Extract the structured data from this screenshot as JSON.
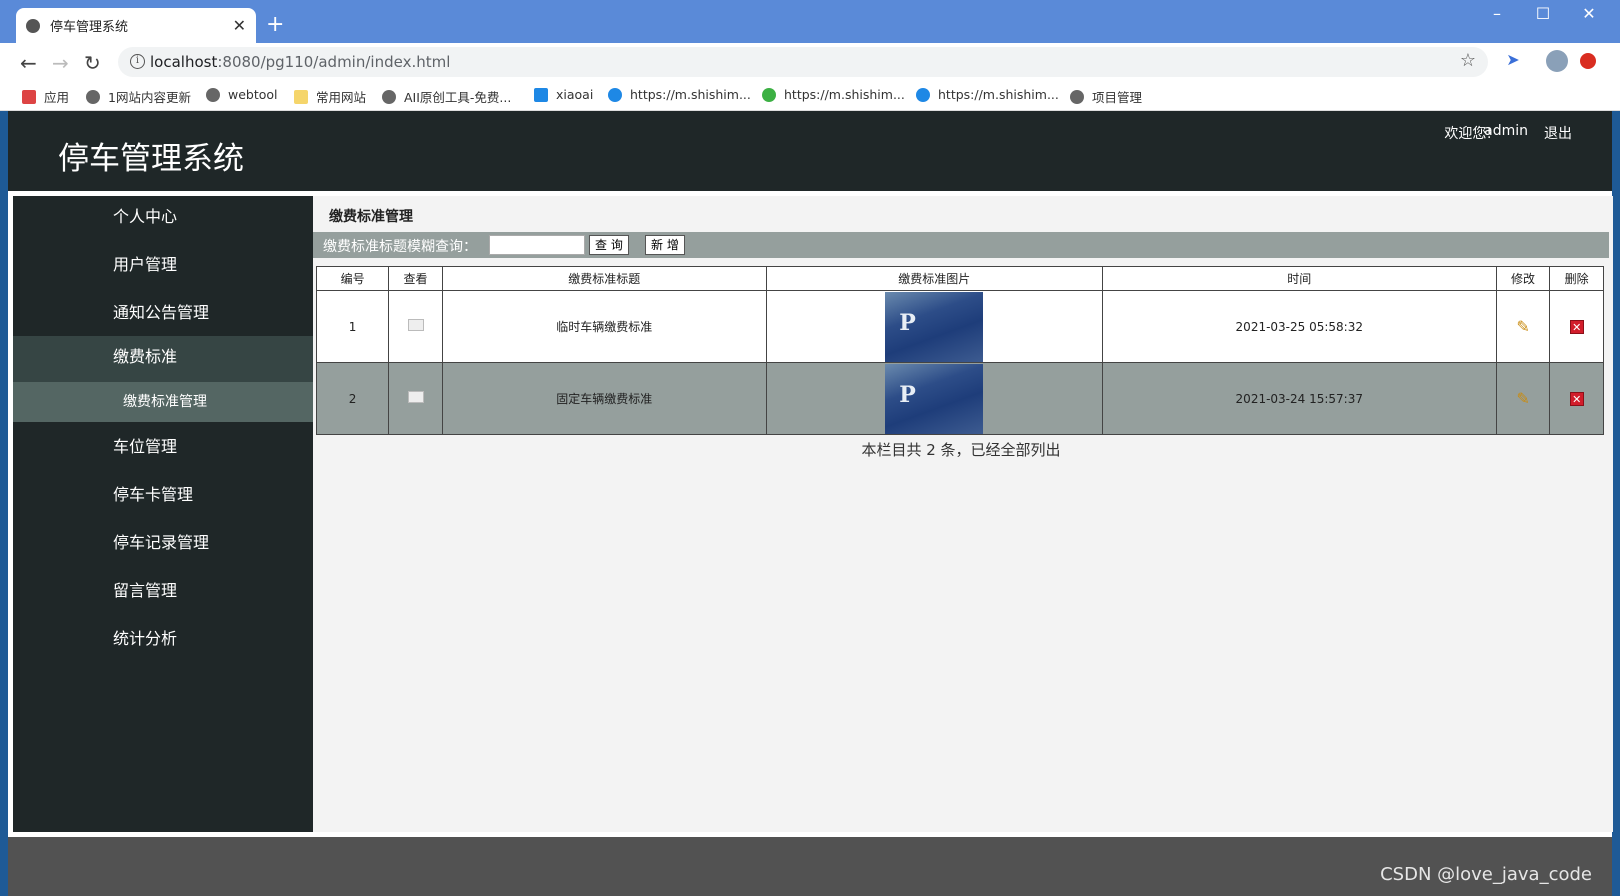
{
  "browser": {
    "tab_title": "停车管理系统",
    "url_host": "localhost",
    "url_rest": ":8080/pg110/admin/index.html",
    "bookmarks": [
      "应用",
      "1网站内容更新",
      "webtool",
      "常用网站",
      "AII原创工具-免费...",
      "xiaoai",
      "https://m.shishim...",
      "https://m.shishim...",
      "https://m.shishim...",
      "项目管理"
    ]
  },
  "header": {
    "title": "停车管理系统",
    "welcome": "欢迎您!",
    "user": "admin",
    "logout": "退出"
  },
  "sidebar": {
    "items": [
      "个人中心",
      "用户管理",
      "通知公告管理",
      "缴费标准",
      "车位管理",
      "停车卡管理",
      "停车记录管理",
      "留言管理",
      "统计分析"
    ],
    "sub_item": "缴费标准管理"
  },
  "main": {
    "section_title": "缴费标准管理",
    "search_label": "缴费标准标题模糊查询：",
    "search_value": "",
    "query_button": "查 询",
    "add_button": "新 增",
    "columns": [
      "编号",
      "查看",
      "缴费标准标题",
      "缴费标准图片",
      "时间",
      "修改",
      "删除"
    ],
    "rows": [
      {
        "id": "1",
        "title": "临时车辆缴费标准",
        "time": "2021-03-25 05:58:32"
      },
      {
        "id": "2",
        "title": "固定车辆缴费标准",
        "time": "2021-03-24 15:57:37"
      }
    ],
    "summary": "本栏目共 2 条，已经全部列出"
  },
  "watermark": "CSDN @love_java_code"
}
